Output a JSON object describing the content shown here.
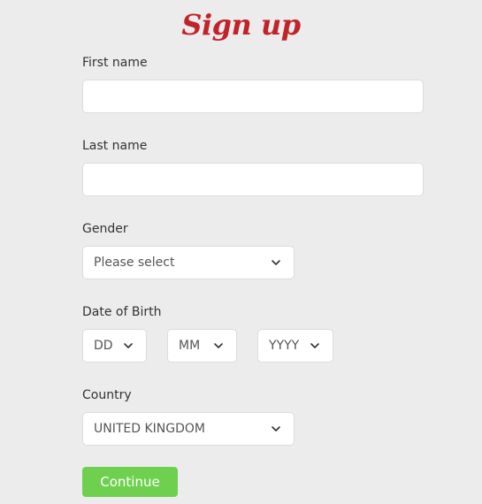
{
  "page": {
    "title": "Sign up"
  },
  "form": {
    "first_name": {
      "label": "First name",
      "value": "",
      "placeholder": ""
    },
    "last_name": {
      "label": "Last name",
      "value": "",
      "placeholder": ""
    },
    "gender": {
      "label": "Gender",
      "selected": "Please select",
      "icon": "chevron-down-icon"
    },
    "dob": {
      "label": "Date of Birth",
      "day": {
        "selected": "DD",
        "icon": "chevron-down-icon"
      },
      "month": {
        "selected": "MM",
        "icon": "chevron-down-icon"
      },
      "year": {
        "selected": "YYYY",
        "icon": "chevron-down-icon"
      }
    },
    "country": {
      "label": "Country",
      "selected": "UNITED KINGDOM",
      "icon": "chevron-down-icon"
    },
    "continue_label": "Continue"
  },
  "colors": {
    "background": "#ececec",
    "title": "#c0242b",
    "button": "#6fd04f",
    "button_text": "#ffffff",
    "field_border": "#dcdcdc"
  }
}
